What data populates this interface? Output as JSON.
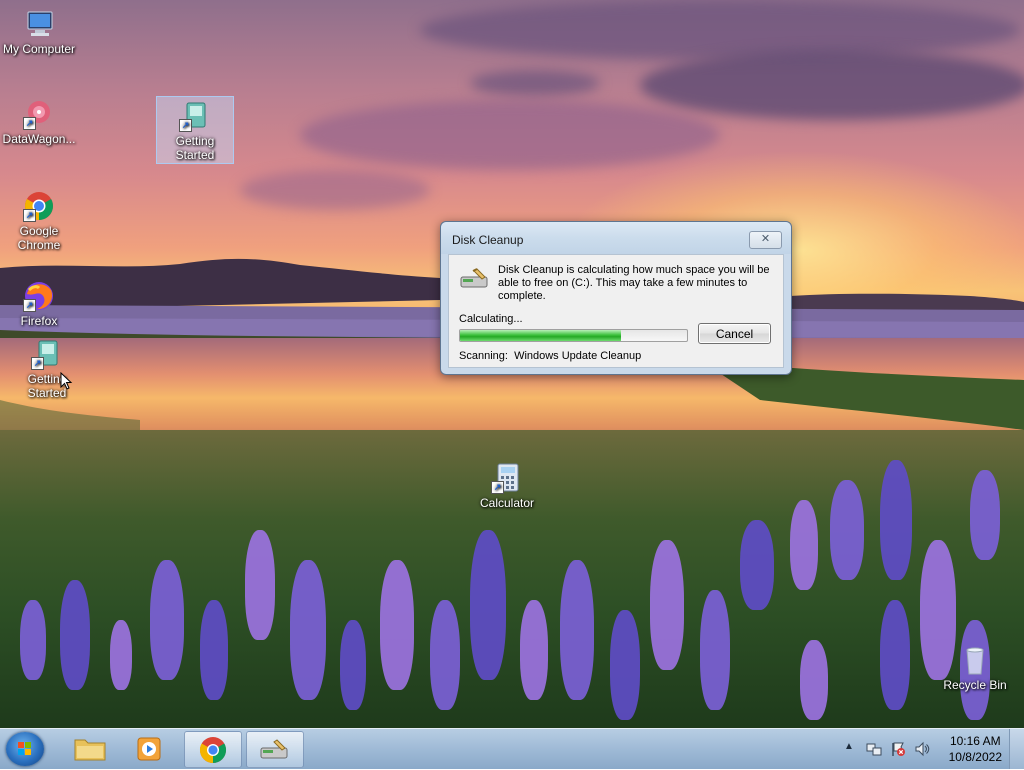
{
  "desktop": {
    "icons": [
      {
        "label": "My Computer",
        "icon": "computer-icon"
      },
      {
        "label": "DataWagon...",
        "icon": "datawagon-icon"
      },
      {
        "label": "Getting Started",
        "icon": "getting-started-icon",
        "selected": true
      },
      {
        "label": "Google Chrome",
        "icon": "chrome-icon"
      },
      {
        "label": "Firefox",
        "icon": "firefox-icon"
      },
      {
        "label": "Getting Started",
        "icon": "getting-started-icon"
      },
      {
        "label": "Calculator",
        "icon": "calculator-icon"
      },
      {
        "label": "Recycle Bin",
        "icon": "recycle-bin-icon"
      }
    ]
  },
  "dialog": {
    "title": "Disk Cleanup",
    "message": "Disk Cleanup is calculating how much space you will be able to free on  (C:). This may take a few minutes to complete.",
    "status": "Calculating...",
    "progress": 0.71,
    "cancel_label": "Cancel",
    "scanning_label": "Scanning:",
    "scanning_item": "Windows Update Cleanup"
  },
  "taskbar": {
    "pinned": [
      {
        "name": "windows-explorer",
        "icon": "folder-icon"
      },
      {
        "name": "windows-media-player",
        "icon": "media-player-icon"
      },
      {
        "name": "google-chrome",
        "icon": "chrome-icon",
        "active": true
      },
      {
        "name": "disk-cleanup",
        "icon": "disk-cleanup-icon",
        "active": true
      }
    ],
    "clock": {
      "time": "10:16 AM",
      "date": "10/8/2022"
    }
  },
  "colors": {
    "progress_fill": "#25a925",
    "taskbar": "#9fbad6",
    "dialog_frame": "#c9d9ea"
  }
}
